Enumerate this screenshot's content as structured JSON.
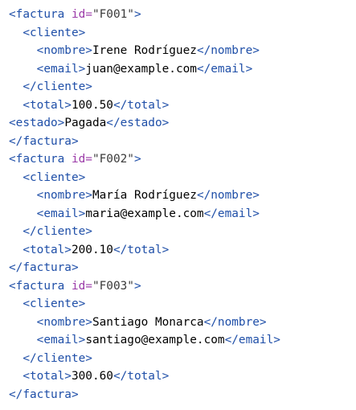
{
  "colors": {
    "tag": "#1f4fa8",
    "attribute": "#9b3aa8",
    "attribute_value": "#3a3a3a",
    "text": "#000000",
    "background": "#ffffff"
  },
  "lines": [
    [
      {
        "t": "tag",
        "v": "<factura "
      },
      {
        "t": "attr",
        "v": "id="
      },
      {
        "t": "val",
        "v": "\"F001\""
      },
      {
        "t": "tag",
        "v": ">"
      }
    ],
    [
      {
        "t": "tag",
        "v": "  <cliente>"
      }
    ],
    [
      {
        "t": "tag",
        "v": "    <nombre>"
      },
      {
        "t": "text",
        "v": "Irene Rodríguez"
      },
      {
        "t": "tag",
        "v": "</nombre>"
      }
    ],
    [
      {
        "t": "tag",
        "v": "    <email>"
      },
      {
        "t": "text",
        "v": "juan@example.com"
      },
      {
        "t": "tag",
        "v": "</email>"
      }
    ],
    [
      {
        "t": "tag",
        "v": "  </cliente>"
      }
    ],
    [
      {
        "t": "tag",
        "v": "  <total>"
      },
      {
        "t": "text",
        "v": "100.50"
      },
      {
        "t": "tag",
        "v": "</total>"
      }
    ],
    [
      {
        "t": "tag",
        "v": "<estado>"
      },
      {
        "t": "text",
        "v": "Pagada"
      },
      {
        "t": "tag",
        "v": "</estado>"
      }
    ],
    [
      {
        "t": "tag",
        "v": "</factura>"
      }
    ],
    [
      {
        "t": "tag",
        "v": "<factura "
      },
      {
        "t": "attr",
        "v": "id="
      },
      {
        "t": "val",
        "v": "\"F002\""
      },
      {
        "t": "tag",
        "v": ">"
      }
    ],
    [
      {
        "t": "tag",
        "v": "  <cliente>"
      }
    ],
    [
      {
        "t": "tag",
        "v": "    <nombre>"
      },
      {
        "t": "text",
        "v": "María Rodríguez"
      },
      {
        "t": "tag",
        "v": "</nombre>"
      }
    ],
    [
      {
        "t": "tag",
        "v": "    <email>"
      },
      {
        "t": "text",
        "v": "maria@example.com"
      },
      {
        "t": "tag",
        "v": "</email>"
      }
    ],
    [
      {
        "t": "tag",
        "v": "  </cliente>"
      }
    ],
    [
      {
        "t": "tag",
        "v": "  <total>"
      },
      {
        "t": "text",
        "v": "200.10"
      },
      {
        "t": "tag",
        "v": "</total>"
      }
    ],
    [
      {
        "t": "tag",
        "v": "</factura>"
      }
    ],
    [
      {
        "t": "tag",
        "v": "<factura "
      },
      {
        "t": "attr",
        "v": "id="
      },
      {
        "t": "val",
        "v": "\"F003\""
      },
      {
        "t": "tag",
        "v": ">"
      }
    ],
    [
      {
        "t": "tag",
        "v": "  <cliente>"
      }
    ],
    [
      {
        "t": "tag",
        "v": "    <nombre>"
      },
      {
        "t": "text",
        "v": "Santiago Monarca"
      },
      {
        "t": "tag",
        "v": "</nombre>"
      }
    ],
    [
      {
        "t": "tag",
        "v": "    <email>"
      },
      {
        "t": "text",
        "v": "santiago@example.com"
      },
      {
        "t": "tag",
        "v": "</email>"
      }
    ],
    [
      {
        "t": "tag",
        "v": "  </cliente>"
      }
    ],
    [
      {
        "t": "tag",
        "v": "  <total>"
      },
      {
        "t": "text",
        "v": "300.60"
      },
      {
        "t": "tag",
        "v": "</total>"
      }
    ],
    [
      {
        "t": "tag",
        "v": "</factura>"
      }
    ]
  ]
}
